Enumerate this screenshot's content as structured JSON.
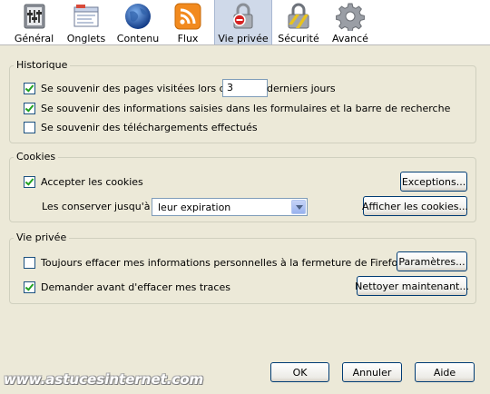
{
  "tabs": [
    {
      "label": "Général",
      "icon": "general-icon"
    },
    {
      "label": "Onglets",
      "icon": "tabs-icon"
    },
    {
      "label": "Contenu",
      "icon": "content-globe-icon"
    },
    {
      "label": "Flux",
      "icon": "rss-feed-icon"
    },
    {
      "label": "Vie privée",
      "icon": "privacy-mask-icon",
      "selected": true
    },
    {
      "label": "Sécurité",
      "icon": "security-lock-icon"
    },
    {
      "label": "Avancé",
      "icon": "advanced-gear-icon"
    }
  ],
  "history": {
    "title": "Historique",
    "remember_pages_label": "Se souvenir des pages visitées lors des",
    "days_value": "3",
    "days_suffix": "derniers jours",
    "remember_pages_checked": true,
    "remember_forms_label": "Se souvenir des informations saisies dans les formulaires et la barre de recherche",
    "remember_forms_checked": true,
    "remember_downloads_label": "Se souvenir des téléchargements effectués",
    "remember_downloads_checked": false
  },
  "cookies": {
    "title": "Cookies",
    "accept_label": "Accepter les cookies",
    "accept_checked": true,
    "exceptions_button": "Exceptions...",
    "keep_until_label": "Les conserver jusqu'à :",
    "keep_until_value": "leur expiration",
    "show_cookies_button": "Afficher les cookies..."
  },
  "private": {
    "title": "Vie privée",
    "always_clear_label": "Toujours effacer mes informations personnelles à la fermeture de Firefox",
    "always_clear_checked": false,
    "settings_button": "Paramètres...",
    "ask_before_label": "Demander avant d'effacer mes traces",
    "ask_before_checked": true,
    "clear_now_button": "Nettoyer maintenant..."
  },
  "footer": {
    "ok": "OK",
    "cancel": "Annuler",
    "help": "Aide"
  },
  "watermark": "www.astucesinternet.com"
}
